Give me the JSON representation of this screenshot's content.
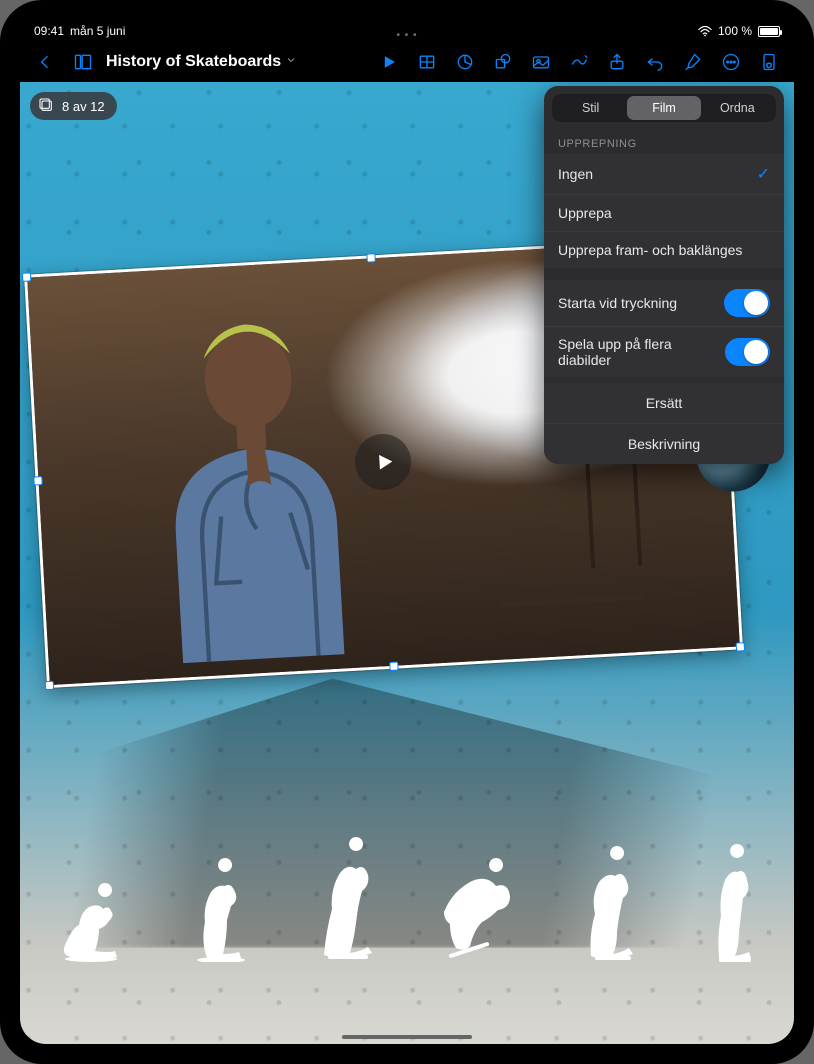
{
  "status": {
    "time": "09:41",
    "date": "mån 5 juni",
    "battery_text": "100 %"
  },
  "document": {
    "title": "History of Skateboards"
  },
  "slide_counter": {
    "label": "8 av 12"
  },
  "popover": {
    "tabs": {
      "style": "Stil",
      "film": "Film",
      "arrange": "Ordna",
      "active": "film"
    },
    "section_repeat": "UPPREPNING",
    "options": {
      "none": "Ingen",
      "repeat": "Upprepa",
      "repeat_fwd_back": "Upprepa fram- och baklänges",
      "selected": "none"
    },
    "toggles": {
      "start_on_tap": {
        "label": "Starta vid tryckning",
        "on": true
      },
      "play_across": {
        "label": "Spela upp på flera diabilder",
        "on": true
      }
    },
    "buttons": {
      "replace": "Ersätt",
      "description": "Beskrivning"
    }
  }
}
